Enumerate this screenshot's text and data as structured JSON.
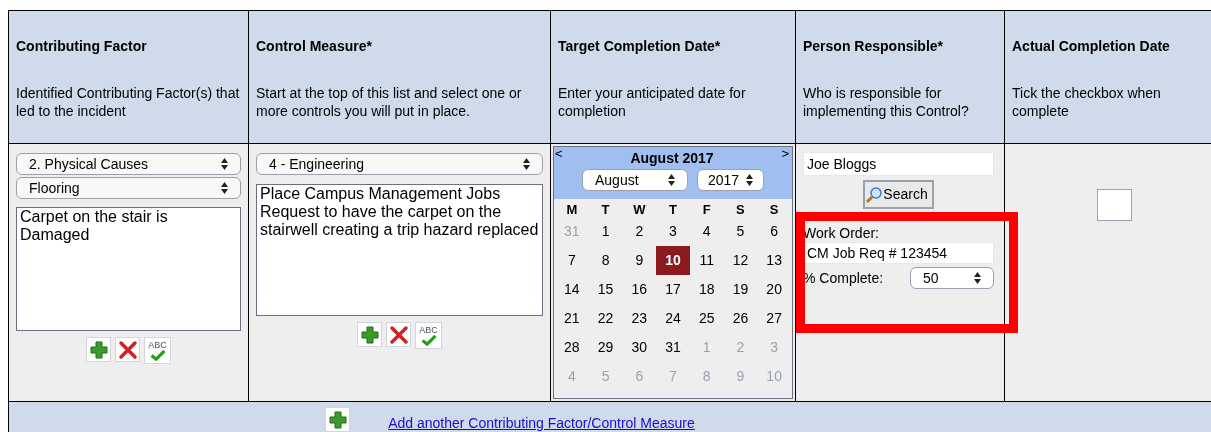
{
  "columns": [
    {
      "title": "Contributing Factor",
      "hint": "Identified Contributing Factor(s) that led to the incident"
    },
    {
      "title": "Control Measure*",
      "hint": "Start at the top of this list and select one or more controls you will put in place."
    },
    {
      "title": "Target Completion Date*",
      "hint": "Enter your anticipated date for completion"
    },
    {
      "title": "Person Responsible*",
      "hint": "Who is responsible for implementing this Control?"
    },
    {
      "title": "Actual Completion Date",
      "hint": "Tick the checkbox when complete"
    }
  ],
  "factor": {
    "category": "2. Physical Causes",
    "subcategory": "Flooring",
    "description": "Carpet on the stair is Damaged",
    "spellcheck_label": "ABC"
  },
  "measure": {
    "type": "4 - Engineering",
    "description": "Place Campus Management Jobs Request to have the carpet on the stairwell creating a trip hazard replaced",
    "spellcheck_label": "ABC"
  },
  "calendar": {
    "prev": "<",
    "next": ">",
    "title": "August 2017",
    "month": "August",
    "year": "2017",
    "weekdays": [
      "M",
      "T",
      "W",
      "T",
      "F",
      "S",
      "S"
    ],
    "weeks": [
      [
        {
          "day": "31",
          "in_month": false,
          "selected": false
        },
        {
          "day": "1",
          "in_month": true,
          "selected": false
        },
        {
          "day": "2",
          "in_month": true,
          "selected": false
        },
        {
          "day": "3",
          "in_month": true,
          "selected": false
        },
        {
          "day": "4",
          "in_month": true,
          "selected": false
        },
        {
          "day": "5",
          "in_month": true,
          "selected": false
        },
        {
          "day": "6",
          "in_month": true,
          "selected": false
        }
      ],
      [
        {
          "day": "7",
          "in_month": true,
          "selected": false
        },
        {
          "day": "8",
          "in_month": true,
          "selected": false
        },
        {
          "day": "9",
          "in_month": true,
          "selected": false
        },
        {
          "day": "10",
          "in_month": true,
          "selected": true
        },
        {
          "day": "11",
          "in_month": true,
          "selected": false
        },
        {
          "day": "12",
          "in_month": true,
          "selected": false
        },
        {
          "day": "13",
          "in_month": true,
          "selected": false
        }
      ],
      [
        {
          "day": "14",
          "in_month": true,
          "selected": false
        },
        {
          "day": "15",
          "in_month": true,
          "selected": false
        },
        {
          "day": "16",
          "in_month": true,
          "selected": false
        },
        {
          "day": "17",
          "in_month": true,
          "selected": false
        },
        {
          "day": "18",
          "in_month": true,
          "selected": false
        },
        {
          "day": "19",
          "in_month": true,
          "selected": false
        },
        {
          "day": "20",
          "in_month": true,
          "selected": false
        }
      ],
      [
        {
          "day": "21",
          "in_month": true,
          "selected": false
        },
        {
          "day": "22",
          "in_month": true,
          "selected": false
        },
        {
          "day": "23",
          "in_month": true,
          "selected": false
        },
        {
          "day": "24",
          "in_month": true,
          "selected": false
        },
        {
          "day": "25",
          "in_month": true,
          "selected": false
        },
        {
          "day": "26",
          "in_month": true,
          "selected": false
        },
        {
          "day": "27",
          "in_month": true,
          "selected": false
        }
      ],
      [
        {
          "day": "28",
          "in_month": true,
          "selected": false
        },
        {
          "day": "29",
          "in_month": true,
          "selected": false
        },
        {
          "day": "30",
          "in_month": true,
          "selected": false
        },
        {
          "day": "31",
          "in_month": true,
          "selected": false
        },
        {
          "day": "1",
          "in_month": false,
          "selected": false
        },
        {
          "day": "2",
          "in_month": false,
          "selected": false
        },
        {
          "day": "3",
          "in_month": false,
          "selected": false
        }
      ],
      [
        {
          "day": "4",
          "in_month": false,
          "selected": false
        },
        {
          "day": "5",
          "in_month": false,
          "selected": false
        },
        {
          "day": "6",
          "in_month": false,
          "selected": false
        },
        {
          "day": "7",
          "in_month": false,
          "selected": false
        },
        {
          "day": "8",
          "in_month": false,
          "selected": false
        },
        {
          "day": "9",
          "in_month": false,
          "selected": false
        },
        {
          "day": "10",
          "in_month": false,
          "selected": false
        }
      ]
    ]
  },
  "person": {
    "name": "Joe Bloggs",
    "search_button": "Search",
    "work_order_label": "Work Order:",
    "work_order": "CM Job Req # 123454",
    "percent_label": "% Complete:",
    "percent": "50"
  },
  "completed": {
    "checked": false
  },
  "add_link": "Add another Contributing Factor/Control Measure"
}
